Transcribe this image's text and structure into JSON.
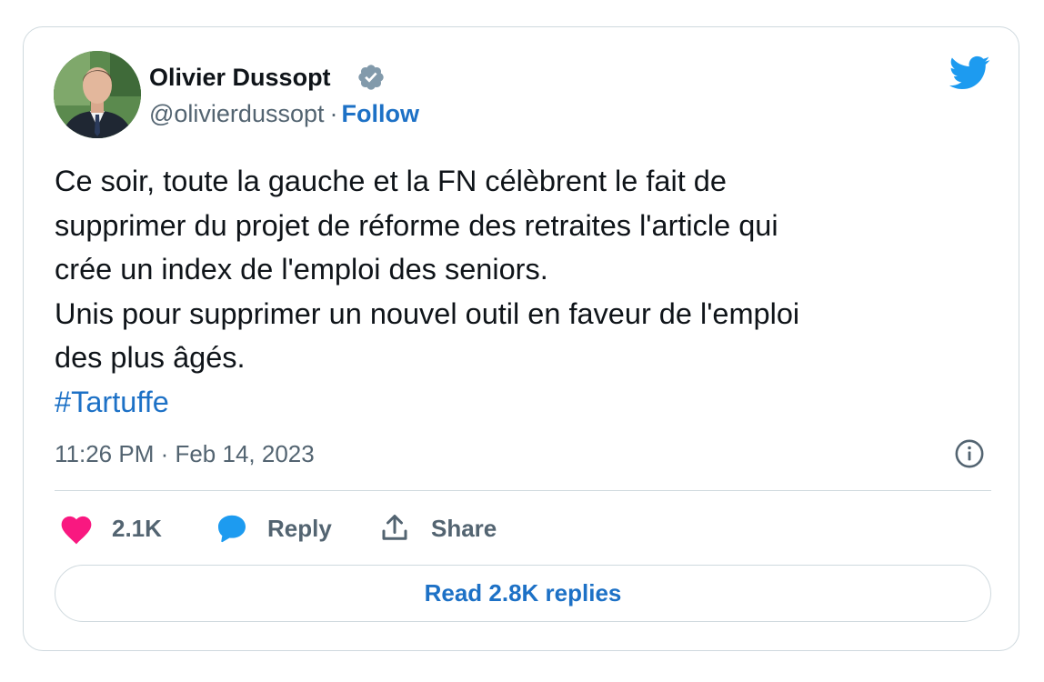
{
  "author": {
    "name": "Olivier Dussopt",
    "handle": "@olivierdussopt",
    "separator": "·",
    "follow_label": "Follow",
    "verified": true,
    "verified_badge_color": "#829aab"
  },
  "tweet": {
    "lines": [
      "Ce soir, toute la gauche et la FN célèbrent le fait de",
      "supprimer du projet de réforme des retraites l'article qui",
      "crée un index de l'emploi des seniors.",
      "Unis pour supprimer un nouvel outil en faveur de l'emploi",
      "des plus âgés."
    ],
    "hashtag": "#Tartuffe",
    "timestamp": "11:26 PM · Feb 14, 2023"
  },
  "actions": {
    "like_count": "2.1K",
    "reply_label": "Reply",
    "share_label": "Share",
    "read_replies_label": "Read 2.8K replies"
  },
  "icons": {
    "brand": "twitter-bird-icon",
    "verified": "verified-badge-icon",
    "info": "info-icon",
    "like": "heart-icon",
    "reply": "speech-bubble-icon",
    "share": "share-upload-icon"
  },
  "colors": {
    "link": "#1d71c6",
    "twitter_blue": "#1d9bf0",
    "like_pink": "#f91880",
    "secondary_text": "#536471",
    "border": "#cfd9de"
  }
}
